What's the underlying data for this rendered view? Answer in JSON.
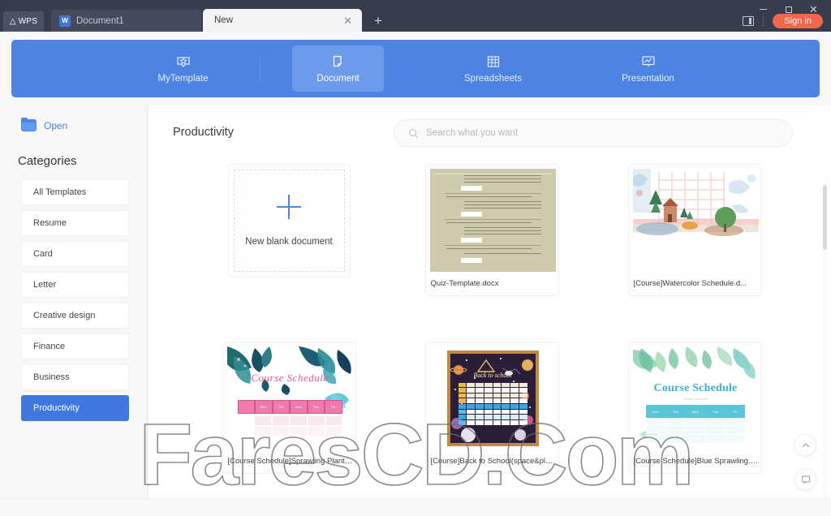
{
  "titlebar": {
    "logo": "WPS",
    "logo_icon": "wps-logo-icon",
    "tabs": [
      {
        "label": "Document1",
        "icon": "writer-doc-icon",
        "active": false
      },
      {
        "label": "New",
        "active": true,
        "close_icon": "close-icon"
      }
    ],
    "new_tab_icon": "plus-icon",
    "panel_icon": "side-panel-icon",
    "signin_label": "Sign in",
    "window_controls": {
      "minimize": "minimize-icon",
      "maximize": "maximize-icon",
      "close": "close-icon"
    }
  },
  "nav": {
    "accent": "#4d83e3",
    "active_bg": "#6d9aea",
    "items": [
      {
        "label": "MyTemplate",
        "icon": "star-template-icon",
        "active": false
      },
      {
        "label": "Document",
        "icon": "document-icon",
        "active": true
      },
      {
        "label": "Spreadsheets",
        "icon": "spreadsheet-grid-icon",
        "active": false
      },
      {
        "label": "Presentation",
        "icon": "presentation-icon",
        "active": false
      }
    ]
  },
  "sidebar": {
    "open_label": "Open",
    "open_icon": "folder-icon",
    "categories_title": "Categories",
    "categories": [
      {
        "label": "All Templates",
        "active": false
      },
      {
        "label": "Resume",
        "active": false
      },
      {
        "label": "Card",
        "active": false
      },
      {
        "label": "Letter",
        "active": false
      },
      {
        "label": "Creative design",
        "active": false
      },
      {
        "label": "Finance",
        "active": false
      },
      {
        "label": "Business",
        "active": false
      },
      {
        "label": "Productivity",
        "active": true
      }
    ],
    "active_color": "#4078e0"
  },
  "main": {
    "title": "Productivity",
    "search": {
      "placeholder": "Search what you want",
      "value": "",
      "icon": "search-icon"
    },
    "blank_card": {
      "label": "New blank document",
      "icon": "plus-icon"
    },
    "templates": [
      {
        "name": "Quiz-Template.docx",
        "thumb": "quiz",
        "boxed": true
      },
      {
        "name": "[Course]Watercolor Schedule.d...",
        "thumb": "watercolor",
        "boxed": true
      },
      {
        "name": "[Course Schedule]Sprawling Plants.docx",
        "thumb": "sprawling",
        "boxed": true,
        "title_text": "Course Schedule",
        "days": [
          "Mon",
          "Tue",
          "Wed",
          "Thu",
          "Fri"
        ]
      },
      {
        "name": "[Course]Back to School(space&planet).docx",
        "thumb": "backtoschool",
        "boxed": true,
        "title_text": "Back to school"
      },
      {
        "name": "[Course Schedule]Blue Sprawling.docx",
        "thumb": "bluesprawling",
        "boxed": true,
        "title_text": "Course Schedule",
        "subtitle_text": "course summary",
        "days": [
          "Mon",
          "Tue",
          "Wed",
          "Thu",
          "Fri"
        ]
      }
    ],
    "fabs": [
      {
        "name": "scroll-to-top",
        "icon": "chevron-up-icon"
      },
      {
        "name": "feedback",
        "icon": "feedback-icon"
      }
    ]
  },
  "watermark": {
    "text": "FaresCD.Com"
  }
}
